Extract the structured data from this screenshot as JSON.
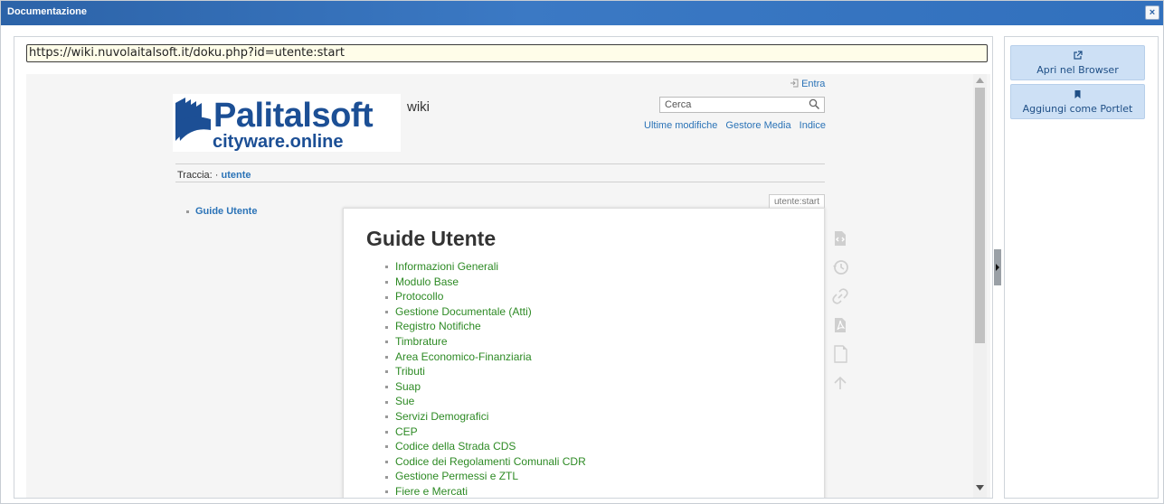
{
  "window": {
    "title": "Documentazione",
    "close_label": "×"
  },
  "address": {
    "url": "https://wiki.nuvolaitalsoft.it/doku.php?id=utente:start"
  },
  "wiki": {
    "logo_name": "Palitalsoft",
    "logo_sub": "cityware.online",
    "wiki_word": "wiki",
    "login_label": "Entra",
    "search_placeholder": "Cerca",
    "toplinks": [
      "Ultime modifiche",
      "Gestore Media",
      "Indice"
    ],
    "breadcrumb_prefix": "Traccia:",
    "breadcrumb_sep": "·",
    "breadcrumb_current": "utente",
    "sidebar_items": [
      "Guide Utente"
    ],
    "page_id": "utente:start",
    "page_title": "Guide Utente",
    "guides": [
      "Informazioni Generali",
      "Modulo Base",
      "Protocollo",
      "Gestione Documentale (Atti)",
      "Registro Notifiche",
      "Timbrature",
      "Area Economico-Finanziaria",
      "Tributi",
      "Suap",
      "Sue",
      "Servizi Demografici",
      "CEP",
      "Codice della Strada CDS",
      "Codice dei Regolamenti Comunali CDR",
      "Gestione Permessi e ZTL",
      "Fiere e Mercati"
    ],
    "page_tools_icons": [
      "source-icon",
      "history-icon",
      "backlinks-icon",
      "pdf-export-icon",
      "blank-page-icon",
      "back-to-top-icon"
    ]
  },
  "side_actions": [
    {
      "label": "Apri nel Browser",
      "icon": "external-link-icon"
    },
    {
      "label": "Aggiungi come Portlet",
      "icon": "bookmark-icon"
    }
  ],
  "colors": {
    "titlebar": "#3170bd",
    "link": "#2b73b7",
    "guide_link": "#2d8a24",
    "url_bg": "#fffde9",
    "side_button": "#cde0f5"
  }
}
